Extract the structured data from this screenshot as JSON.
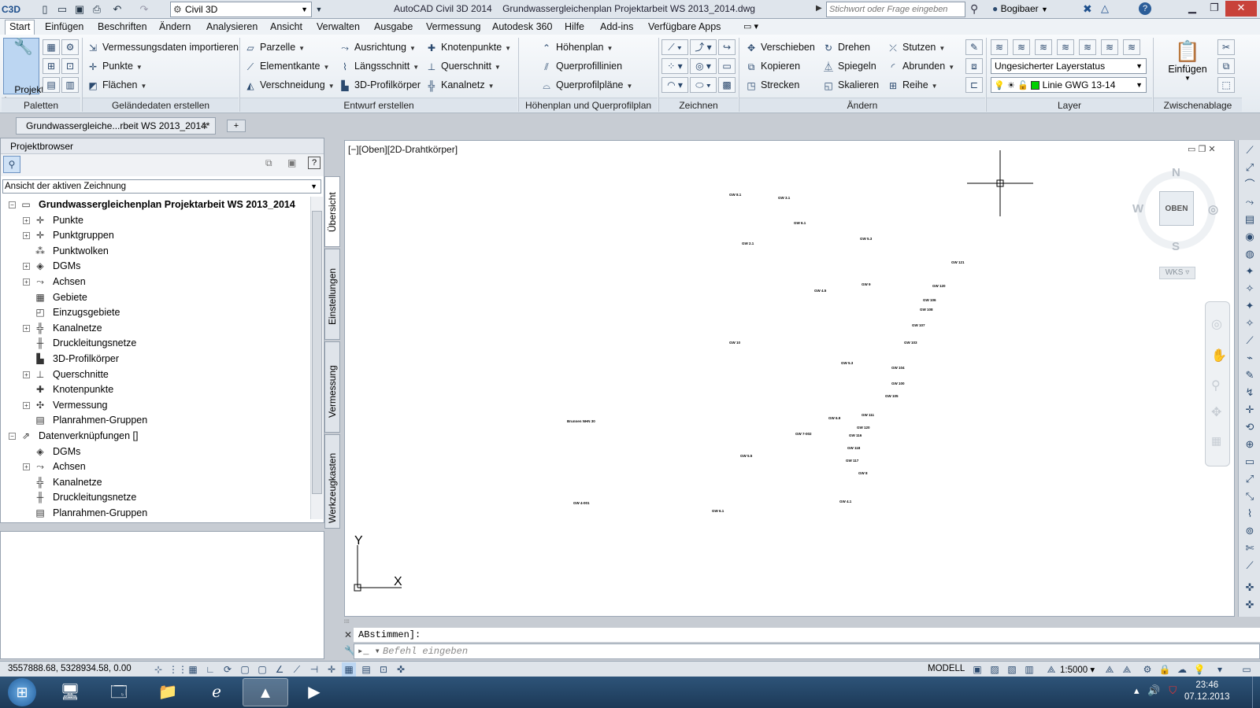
{
  "titlebar": {
    "workspace": "Civil 3D",
    "app_title": "AutoCAD Civil 3D 2014",
    "file_title": "Grundwassergleichenplan Projektarbeit WS 2013_2014.dwg",
    "search_placeholder": "Stichwort oder Frage eingeben",
    "user": "Bogibaer",
    "app_logo": "C3D"
  },
  "menu_tabs": [
    "Start",
    "Einfügen",
    "Beschriften",
    "Ändern",
    "Analysieren",
    "Ansicht",
    "Verwalten",
    "Ausgabe",
    "Vermessung",
    "Autodesk 360",
    "Hilfe",
    "Add-ins",
    "Verfügbare Apps"
  ],
  "ribbon": {
    "paletten": {
      "button": "Projekt-\nbrowser",
      "title": "Paletten"
    },
    "gelaende": {
      "items": [
        "Vermessungsdaten importieren",
        "Punkte",
        "Flächen"
      ],
      "title": "Geländedaten erstellen"
    },
    "entwurf": {
      "items": [
        "Parzelle",
        "Elementkante",
        "Verschneidung",
        "Ausrichtung",
        "Längsschnitt",
        "3D-Profilkörper",
        "Knotenpunkte",
        "Querschnitt",
        "Kanalnetz"
      ],
      "title": "Entwurf erstellen"
    },
    "hoehenplan": {
      "items": [
        "Höhenplan",
        "Querprofillinien",
        "Querprofilpläne"
      ],
      "title": "Höhenplan und Querprofilplan"
    },
    "zeichnen": {
      "title": "Zeichnen"
    },
    "aendern": {
      "items": [
        "Verschieben",
        "Kopieren",
        "Strecken",
        "Drehen",
        "Spiegeln",
        "Skalieren",
        "Stutzen",
        "Abrunden",
        "Reihe"
      ],
      "title": "Ändern"
    },
    "layer": {
      "status": "Ungesicherter Layerstatus",
      "current": "Linie GWG 13-14",
      "title": "Layer",
      "layer_color": "#00d000"
    },
    "zwischenablage": {
      "button": "Einfügen",
      "title": "Zwischenablage"
    }
  },
  "doc_tab": {
    "label": "Grundwassergleiche...rbeit WS 2013_2014*"
  },
  "project_browser": {
    "title": "Projektbrowser",
    "view_select": "Ansicht der aktiven Zeichnung",
    "tree": [
      {
        "label": "Grundwassergleichenplan Projektarbeit WS 2013_2014",
        "level": 0,
        "exp": "-",
        "bold": true,
        "icon": "drawing-icon"
      },
      {
        "label": "Punkte",
        "level": 1,
        "exp": "+",
        "icon": "points-icon"
      },
      {
        "label": "Punktgruppen",
        "level": 1,
        "exp": "+",
        "icon": "point-groups-icon"
      },
      {
        "label": "Punktwolken",
        "level": 1,
        "exp": "",
        "icon": "point-cloud-icon"
      },
      {
        "label": "DGMs",
        "level": 1,
        "exp": "+",
        "icon": "surface-icon"
      },
      {
        "label": "Achsen",
        "level": 1,
        "exp": "+",
        "icon": "alignment-icon"
      },
      {
        "label": "Gebiete",
        "level": 1,
        "exp": "",
        "icon": "sites-icon"
      },
      {
        "label": "Einzugsgebiete",
        "level": 1,
        "exp": "",
        "icon": "catchment-icon"
      },
      {
        "label": "Kanalnetze",
        "level": 1,
        "exp": "+",
        "icon": "pipe-network-icon"
      },
      {
        "label": "Druckleitungsnetze",
        "level": 1,
        "exp": "",
        "icon": "pressure-network-icon"
      },
      {
        "label": "3D-Profilkörper",
        "level": 1,
        "exp": "",
        "icon": "corridor-icon"
      },
      {
        "label": "Querschnitte",
        "level": 1,
        "exp": "+",
        "icon": "assembly-icon"
      },
      {
        "label": "Knotenpunkte",
        "level": 1,
        "exp": "",
        "icon": "intersection-icon"
      },
      {
        "label": "Vermessung",
        "level": 1,
        "exp": "+",
        "icon": "survey-icon"
      },
      {
        "label": "Planrahmen-Gruppen",
        "level": 1,
        "exp": "",
        "icon": "view-frame-icon"
      },
      {
        "label": "Datenverknüpfungen []",
        "level": 0,
        "exp": "-",
        "icon": "data-shortcut-icon"
      },
      {
        "label": "DGMs",
        "level": 1,
        "exp": "",
        "icon": "surface-icon"
      },
      {
        "label": "Achsen",
        "level": 1,
        "exp": "+",
        "icon": "alignment-icon"
      },
      {
        "label": "Kanalnetze",
        "level": 1,
        "exp": "",
        "icon": "pipe-network-icon"
      },
      {
        "label": "Druckleitungsnetze",
        "level": 1,
        "exp": "",
        "icon": "pressure-network-icon"
      },
      {
        "label": "Planrahmen-Gruppen",
        "level": 1,
        "exp": "",
        "icon": "view-frame-icon"
      }
    ],
    "side_tabs": [
      "Übersicht",
      "Einstellungen",
      "Vermessung",
      "Werkzeugkasten"
    ]
  },
  "viewport": {
    "label": "[−][Oben][2D-Drahtkörper]",
    "navcube": {
      "top": "OBEN",
      "n": "N",
      "s": "S",
      "w": "W"
    },
    "ucs": "WKS",
    "axis_x": "X",
    "axis_y": "Y"
  },
  "command": {
    "history": "ABstimmen]:",
    "placeholder": "Befehl eingeben"
  },
  "statusbar": {
    "coords": "3557888.68, 5328934.58, 0.00",
    "model": "MODELL",
    "scale": "1:5000"
  },
  "taskbar": {
    "time": "23:46",
    "date": "07.12.2013"
  }
}
